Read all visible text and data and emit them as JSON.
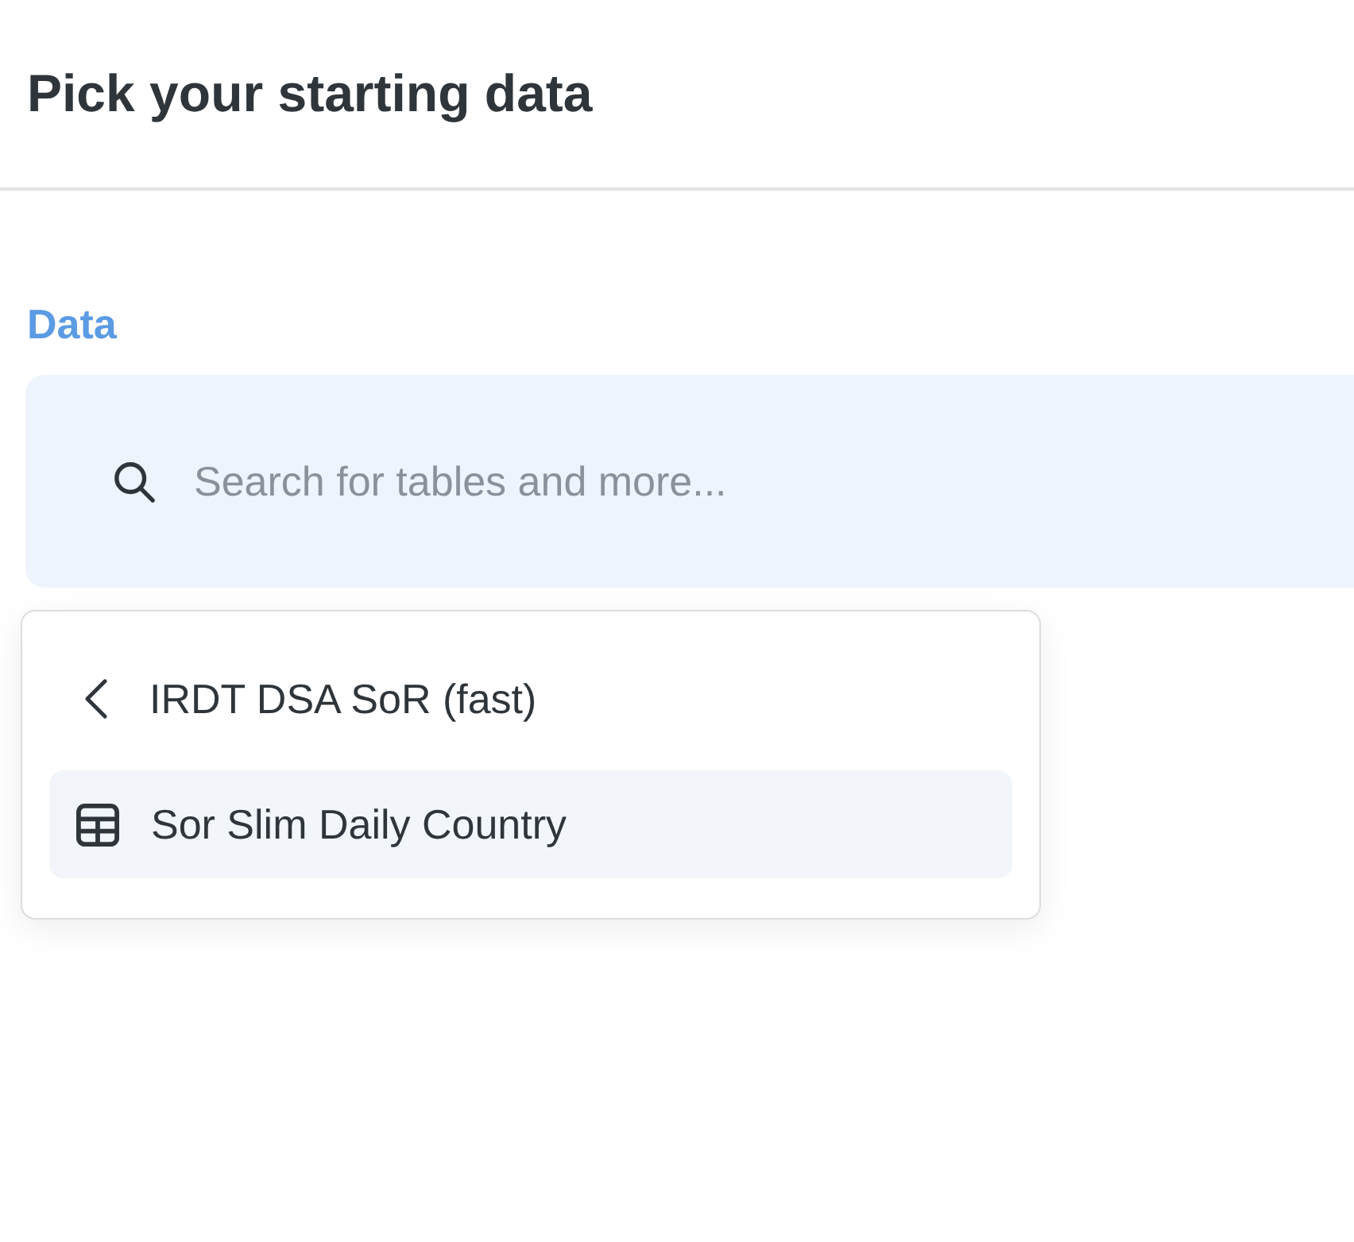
{
  "page": {
    "title": "Pick your starting data"
  },
  "data_field": {
    "label": "Data",
    "placeholder": "Search for tables and more..."
  },
  "dropdown": {
    "back_label": "IRDT DSA SoR (fast)",
    "items": [
      {
        "label": "Sor Slim Daily Country",
        "selected": true
      }
    ]
  }
}
